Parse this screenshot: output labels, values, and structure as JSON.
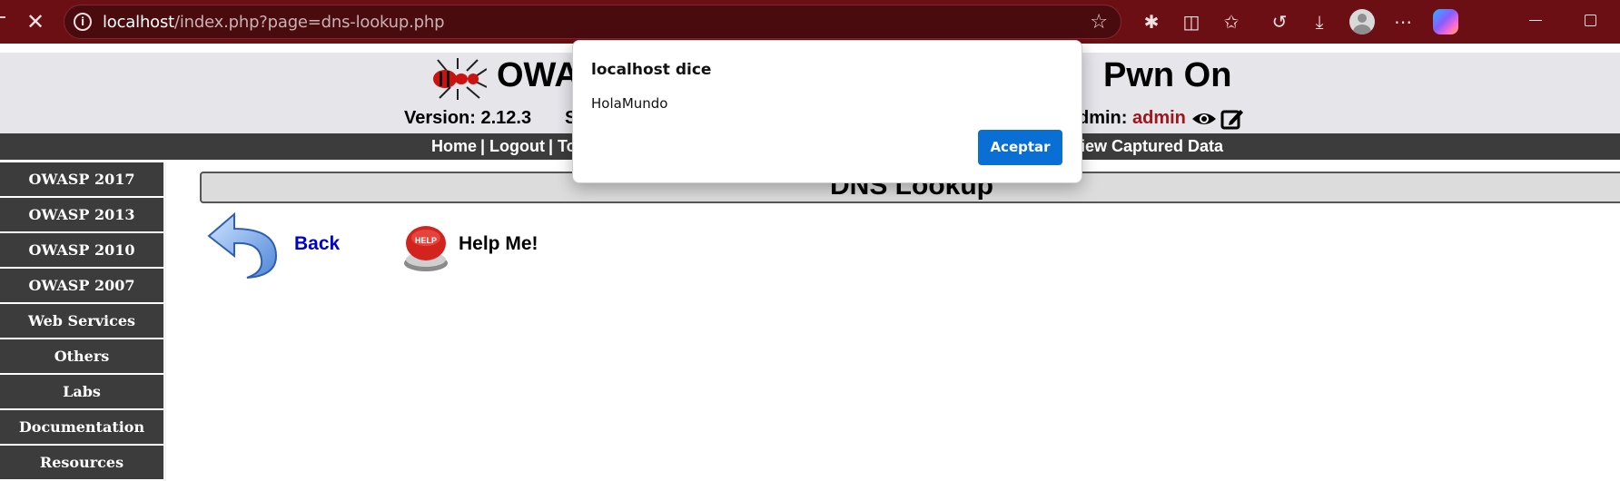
{
  "browser": {
    "url_host": "localhost",
    "url_path": "/index.php?page=dns-lookup.php"
  },
  "header": {
    "title_start": "OWA",
    "title_end": "Pwn On",
    "version": "Version: 2.12.3",
    "security_fragment": "S",
    "admin_label": "dmin: ",
    "admin_user": "admin"
  },
  "menu": {
    "home": "Home",
    "logout": "Logout",
    "toggle_fragment": "To",
    "captured_fragment": "iew Captured Data",
    "separator": "|"
  },
  "sidebar": {
    "items": [
      {
        "label": "OWASP 2017"
      },
      {
        "label": "OWASP 2013"
      },
      {
        "label": "OWASP 2010"
      },
      {
        "label": "OWASP 2007"
      },
      {
        "label": "Web Services"
      },
      {
        "label": "Others"
      },
      {
        "label": "Labs"
      },
      {
        "label": "Documentation"
      },
      {
        "label": "Resources"
      }
    ]
  },
  "content": {
    "page_title": "DNS Lookup",
    "back_label": "Back",
    "help_label": "Help Me!",
    "help_badge": "HELP"
  },
  "dialog": {
    "title": "localhost dice",
    "message": "HolaMundo",
    "ok_label": "Aceptar"
  },
  "colors": {
    "browser_chrome": "#6b0f14",
    "menu_bar": "#3c3c3c",
    "admin_name": "#a0141c",
    "link_blue": "#0000cc",
    "dialog_button": "#0a6fd4"
  }
}
